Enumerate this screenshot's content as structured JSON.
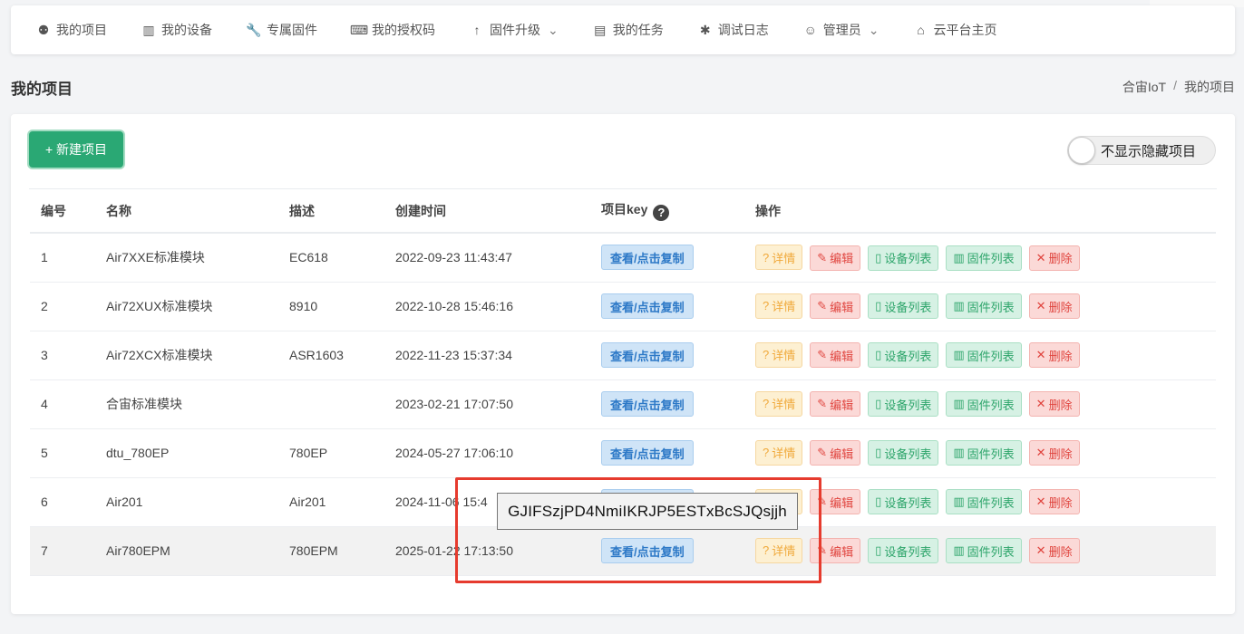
{
  "nav": {
    "items": [
      {
        "label": "我的项目",
        "icon": "lightbulb-icon",
        "glyph": "⚉"
      },
      {
        "label": "我的设备",
        "icon": "chip-icon",
        "glyph": "▥"
      },
      {
        "label": "专属固件",
        "icon": "wrench-icon",
        "glyph": "🔧"
      },
      {
        "label": "我的授权码",
        "icon": "keyboard-icon",
        "glyph": "⌨"
      },
      {
        "label": "固件升级",
        "icon": "arrow-up-icon",
        "glyph": "↑",
        "dropdown": true
      },
      {
        "label": "我的任务",
        "icon": "calendar-icon",
        "glyph": "▤"
      },
      {
        "label": "调试日志",
        "icon": "bug-icon",
        "glyph": "✱"
      },
      {
        "label": "管理员",
        "icon": "user-icon",
        "glyph": "☺",
        "dropdown": true
      },
      {
        "label": "云平台主页",
        "icon": "home-icon",
        "glyph": "⌂"
      }
    ]
  },
  "page": {
    "title": "我的项目",
    "breadcrumb": [
      "合宙IoT",
      "我的项目"
    ]
  },
  "toolbar": {
    "new_label": "+ 新建项目",
    "toggle_label": "不显示隐藏项目"
  },
  "table": {
    "headers": [
      "编号",
      "名称",
      "描述",
      "创建时间",
      "项目key",
      "操作"
    ],
    "key_button": "查看/点击复制",
    "actions": {
      "detail": "详情",
      "edit": "编辑",
      "devices": "设备列表",
      "firmware": "固件列表",
      "delete": "删除"
    },
    "rows": [
      {
        "id": "1",
        "name": "Air7XXE标准模块",
        "desc": "EC618",
        "created": "2022-09-23 11:43:47"
      },
      {
        "id": "2",
        "name": "Air72XUX标准模块",
        "desc": "8910",
        "created": "2022-10-28 15:46:16"
      },
      {
        "id": "3",
        "name": "Air72XCX标准模块",
        "desc": "ASR1603",
        "created": "2022-11-23 15:37:34"
      },
      {
        "id": "4",
        "name": "合宙标准模块",
        "desc": "",
        "created": "2023-02-21 17:07:50"
      },
      {
        "id": "5",
        "name": "dtu_780EP",
        "desc": "780EP",
        "created": "2024-05-27 17:06:10"
      },
      {
        "id": "6",
        "name": "Air201",
        "desc": "Air201",
        "created": "2024-11-06 15:4"
      },
      {
        "id": "7",
        "name": "Air780EPM",
        "desc": "780EPM",
        "created": "2025-01-22 17:13:50"
      }
    ],
    "hover_row": 6
  },
  "tooltip": {
    "text": "GJIFSzjPD4NmiIKRJP5ESTxBcSJQsjjh"
  },
  "colors": {
    "primary_green": "#2aa874",
    "key_blue": "#2d79c7",
    "highlight_red": "#e63b2e"
  }
}
